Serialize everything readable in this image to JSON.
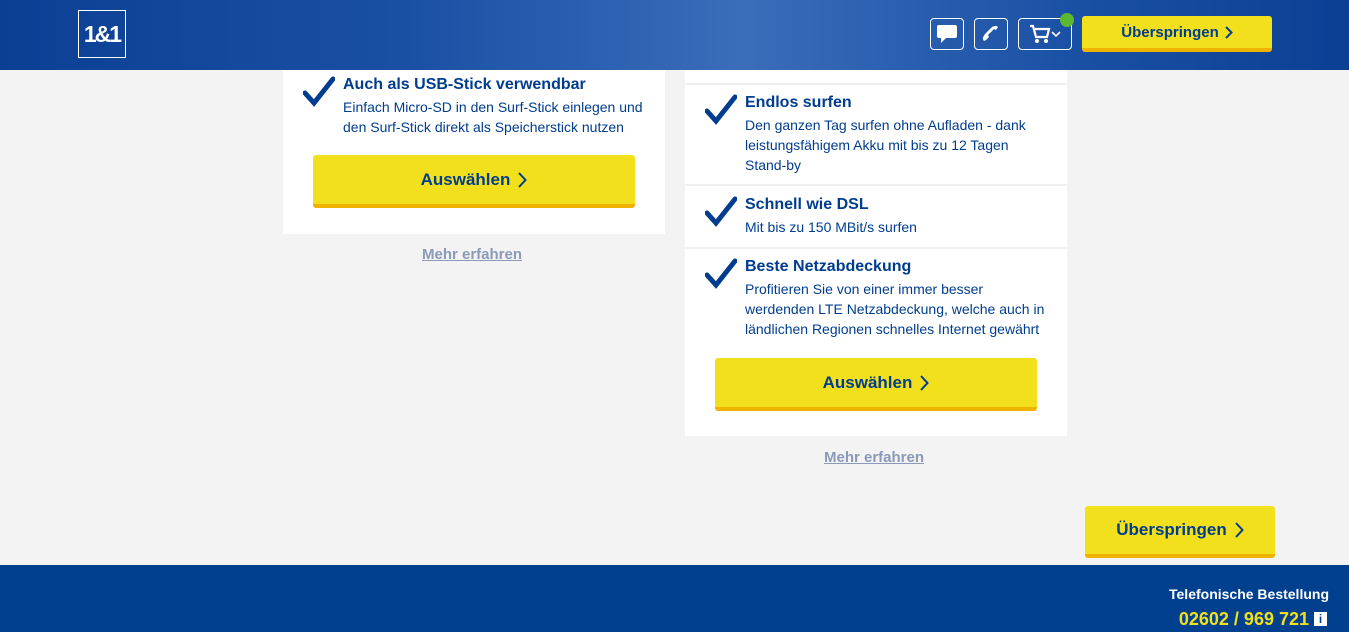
{
  "header": {
    "logo": "1&1",
    "icons": [
      "chat-icon",
      "phone-icon",
      "cart-icon"
    ],
    "skip_label": "Überspringen"
  },
  "card_left": {
    "feature": {
      "title": "Auch als USB-Stick verwendbar",
      "desc": "Einfach Micro-SD in den Surf-Stick einlegen und den Surf-Stick direkt als Speicherstick nutzen"
    },
    "select_label": "Auswählen",
    "more_label": "Mehr erfahren"
  },
  "card_right": {
    "features": [
      {
        "title": "Endlos surfen",
        "desc": "Den ganzen Tag surfen ohne Aufladen - dank leistungsfähigem Akku mit bis zu 12 Tagen Stand-by"
      },
      {
        "title": "Schnell wie DSL",
        "desc": "Mit bis zu 150 MBit/s surfen"
      },
      {
        "title": "Beste Netzabdeckung",
        "desc": "Profitieren Sie von einer immer besser werdenden LTE Netzabdeckung, welche auch in ländlichen Regionen schnelles Internet gewährt"
      }
    ],
    "select_label": "Auswählen",
    "more_label": "Mehr erfahren"
  },
  "skip_bottom_label": "Überspringen",
  "footer": {
    "title": "Telefonische Bestellung",
    "phone": "02602 / 969 721",
    "info": "i"
  },
  "colors": {
    "brand_blue": "#003d8f",
    "brand_yellow": "#f2e01c",
    "accent_green": "#5cb82e"
  }
}
